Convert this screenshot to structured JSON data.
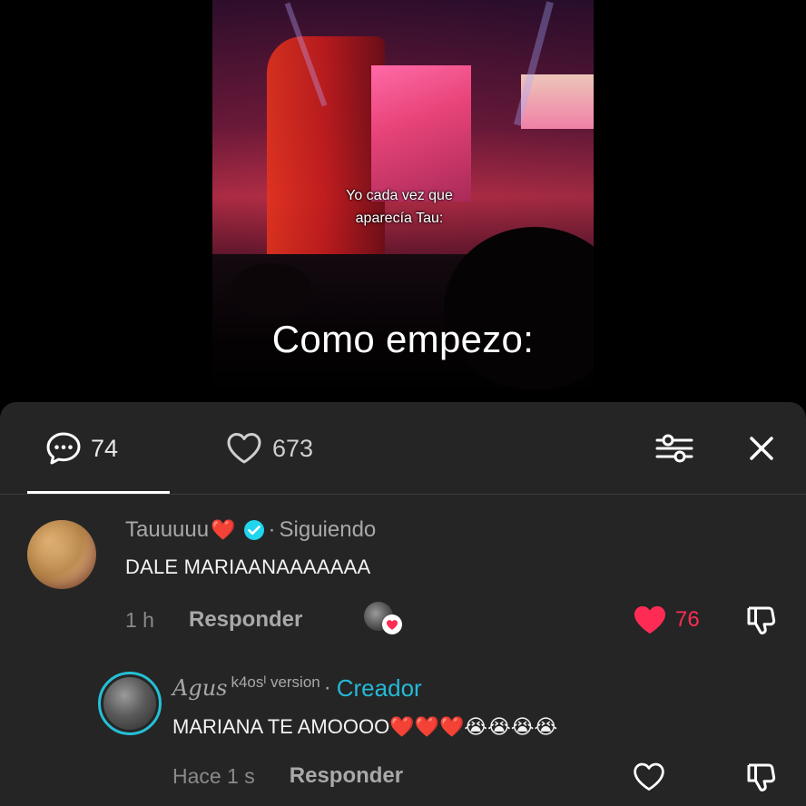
{
  "video": {
    "overlay_line1": "Yo cada vez que",
    "overlay_line2": "aparecía Tau:",
    "caption": "Como empezo:"
  },
  "comments_panel": {
    "tabs": [
      {
        "label": "comments",
        "icon": "comment-bubble-icon",
        "count": "74"
      },
      {
        "label": "likes",
        "icon": "heart-outline-icon",
        "count": "673"
      }
    ],
    "filter_icon": "filter-sliders-icon",
    "close_icon": "close-icon"
  },
  "comments": [
    {
      "author": "Tauuuuu",
      "author_emoji": "❤️",
      "verified": true,
      "separator": "·",
      "relation": "Siguiendo",
      "text": "DALE MARIAANAAAAAAA",
      "time": "1 h",
      "reply_label": "Responder",
      "likes": "76",
      "liked": true
    },
    {
      "author": "Agus",
      "author_suffix": "k4osᴵ version",
      "separator": "·",
      "badge": "Creador",
      "text": "MARIANA TE AMOOOO",
      "text_emojis": "❤️❤️❤️😭😭😭😭",
      "time": "Hace 1 s",
      "reply_label": "Responder",
      "liked": false
    }
  ],
  "colors": {
    "panel_bg": "#252525",
    "accent_like": "#fe2c55",
    "creator_badge": "#25b9d6",
    "verified_badge": "#20d5ec"
  }
}
